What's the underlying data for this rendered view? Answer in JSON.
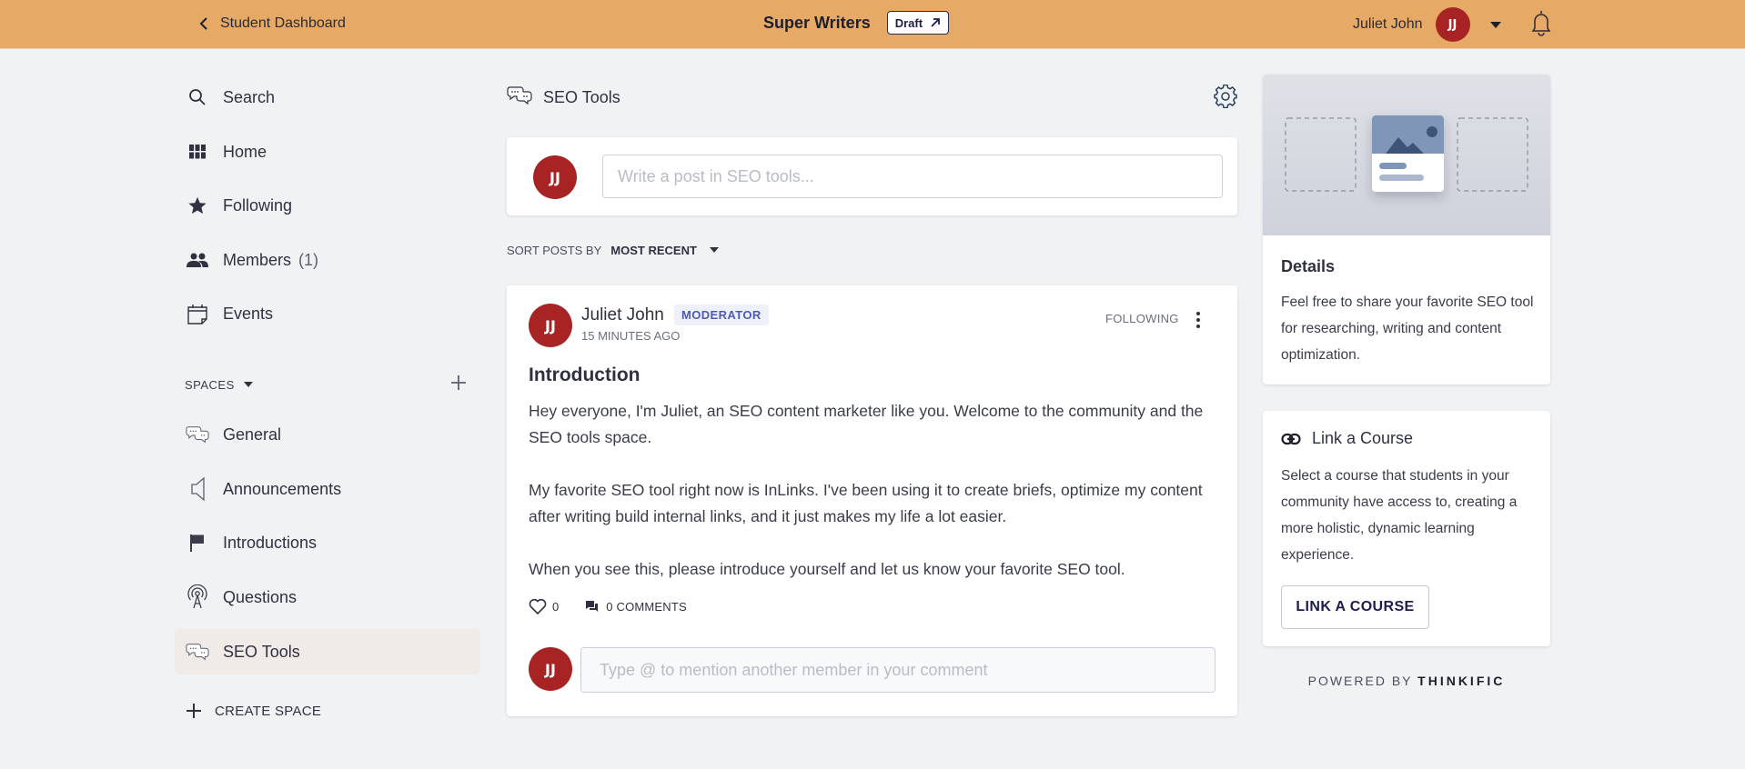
{
  "topbar": {
    "back_label": "Student Dashboard",
    "community_name": "Super Writers",
    "draft_label": "Draft",
    "user_name": "Juliet John",
    "user_initials": "JJ",
    "bar_color": "#e6a966"
  },
  "sidebar": {
    "nav": [
      {
        "label": "Search",
        "icon": "search-icon"
      },
      {
        "label": "Home",
        "icon": "grid-icon"
      },
      {
        "label": "Following",
        "icon": "star-icon"
      },
      {
        "label": "Members",
        "count": "(1)",
        "icon": "people-icon"
      },
      {
        "label": "Events",
        "icon": "calendar-icon"
      }
    ],
    "spaces_label": "SPACES",
    "spaces": [
      {
        "label": "General",
        "icon": "chat-bubbles-icon"
      },
      {
        "label": "Announcements",
        "icon": "megaphone-icon"
      },
      {
        "label": "Introductions",
        "icon": "flag-icon"
      },
      {
        "label": "Questions",
        "icon": "broadcast-icon"
      },
      {
        "label": "SEO Tools",
        "icon": "chat-bubbles-icon",
        "active": true
      }
    ],
    "create_space_label": "CREATE SPACE"
  },
  "main": {
    "space_title": "SEO Tools",
    "composer_placeholder": "Write a post in SEO tools...",
    "sort_label": "SORT POSTS BY",
    "sort_value": "MOST RECENT",
    "post": {
      "author": "Juliet John",
      "author_initials": "JJ",
      "role_badge": "MODERATOR",
      "timestamp": "15 MINUTES AGO",
      "follow_label": "FOLLOWING",
      "title": "Introduction",
      "paragraphs": [
        "Hey everyone, I'm Juliet, an SEO content marketer like you. Welcome to the community and the SEO tools space.",
        "My favorite SEO tool right now is InLinks. I've been using it to create briefs, optimize my content after writing build internal links, and it just makes my life a lot easier.",
        "When you see this, please introduce yourself and let us know your favorite SEO tool."
      ],
      "likes": "0",
      "comments_label": "0 COMMENTS",
      "comment_placeholder": "Type @ to mention another member in your comment"
    }
  },
  "right": {
    "details_title": "Details",
    "details_text": "Feel free to share your favorite SEO tool for researching, writing and content optimization.",
    "link_title": "Link a Course",
    "link_text": "Select a course that students in your community have access to, creating a more holistic, dynamic learning experience.",
    "link_button": "LINK A COURSE",
    "powered_by": "POWERED BY",
    "powered_brand": "THINKIFIC"
  }
}
